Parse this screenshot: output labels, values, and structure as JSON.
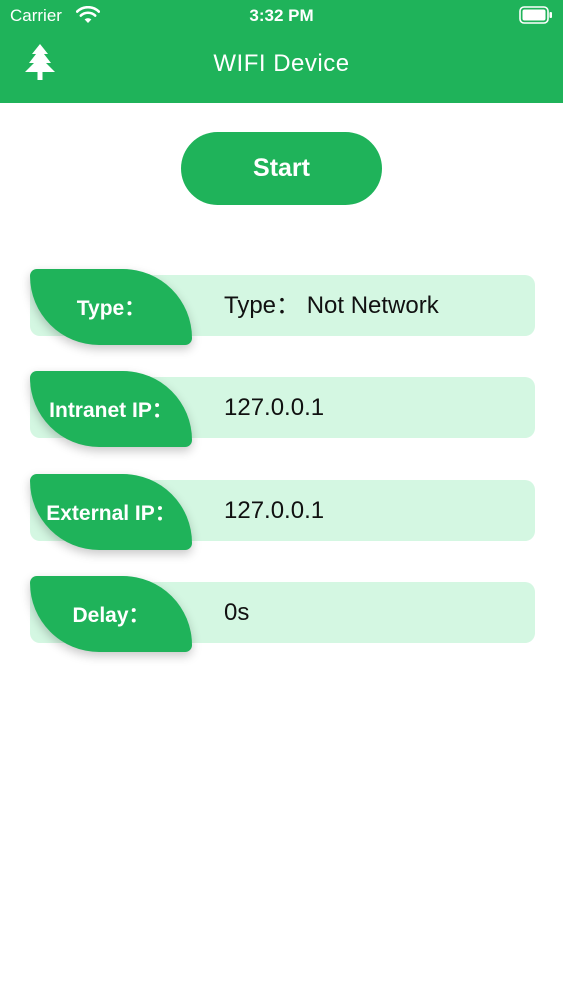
{
  "status_bar": {
    "carrier": "Carrier",
    "time": "3:32 PM",
    "icons": [
      "wifi-icon",
      "battery-icon"
    ]
  },
  "nav": {
    "title": "WIFI Device",
    "left_icon": "tree-icon"
  },
  "start_button": {
    "label": "Start"
  },
  "info": [
    {
      "label": "Type：",
      "value": "Type：  Not Network"
    },
    {
      "label": "Intranet IP：",
      "value": "127.0.0.1"
    },
    {
      "label": "External IP：",
      "value": "127.0.0.1"
    },
    {
      "label": "Delay：",
      "value": "0s"
    }
  ],
  "colors": {
    "accent": "#1fb35a",
    "row_background": "#d4f7e2",
    "page_background": "#ffffff"
  }
}
